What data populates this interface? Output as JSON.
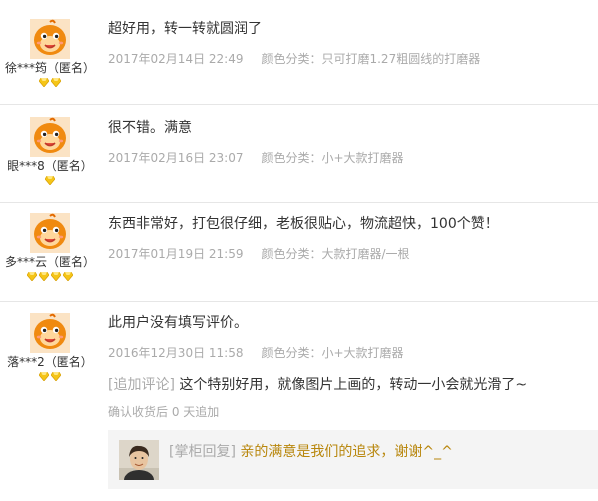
{
  "reviews": [
    {
      "user": "徐***筠（匿名）",
      "badges": 2,
      "text": "超好用，转一转就圆润了",
      "date": "2017年02月14日 22:49",
      "sku": "颜色分类：只可打磨1.27粗圆线的打磨器"
    },
    {
      "user": "眼***8（匿名）",
      "badges": 1,
      "text": "很不错。满意",
      "date": "2017年02月16日 23:07",
      "sku": "颜色分类：小+大款打磨器"
    },
    {
      "user": "多***云（匿名）",
      "badges": 4,
      "text": "东西非常好，打包很仔细，老板很贴心，物流超快，100个赞！",
      "date": "2017年01月19日 21:59",
      "sku": "颜色分类：大款打磨器/一根"
    },
    {
      "user": "落***2（匿名）",
      "badges": 2,
      "text": "此用户没有填写评价。",
      "date": "2016年12月30日 11:58",
      "sku": "颜色分类：小+大款打磨器",
      "append_tag": "[追加评论]",
      "append_text": "这个特别好用，就像图片上画的，转动一小会就光滑了~",
      "append_meta": "确认收货后 0 天追加",
      "reply_tag": "[掌柜回复]",
      "reply_text": "亲的满意是我们的追求，谢谢^_^"
    }
  ],
  "icons": {
    "avatar": "orange-cartoon-avatar-icon",
    "badge": "yellow-diamond-icon",
    "seller_avatar": "seller-photo-avatar"
  },
  "colors": {
    "meta": "#aaaaaa",
    "reply_message": "#b8860b",
    "badge": "#f5c518",
    "reply_background": "#f4f4f4"
  }
}
